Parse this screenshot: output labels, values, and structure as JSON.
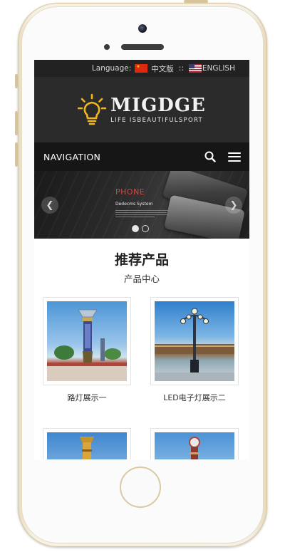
{
  "header": {
    "language_label": "Language:",
    "lang_cn": "中文版",
    "separator": "::",
    "lang_en": "ENGLISH"
  },
  "logo": {
    "brand": "MIGDGE",
    "slogan": "LIFE ISBEAUTIFULSPORT"
  },
  "nav": {
    "title": "NAVIGATION",
    "search_icon": "search-icon",
    "menu_icon": "hamburger-menu-icon"
  },
  "banner": {
    "title": "PHONE",
    "subtitle": "Dedecms System",
    "slide_count": 2,
    "active_slide": 1
  },
  "products": {
    "title": "推荐产品",
    "subtitle": "产品中心",
    "items": [
      {
        "name": "路灯展示一"
      },
      {
        "name": "LED电子灯展示二"
      },
      {
        "name": ""
      },
      {
        "name": ""
      }
    ]
  },
  "colors": {
    "topbar": "#222222",
    "logo_bg": "#2b2b2b",
    "nav_bg": "#161616",
    "accent_red": "#d9443a",
    "bulb_yellow": "#f2b51c",
    "phone_gold": "#d7c49b"
  }
}
